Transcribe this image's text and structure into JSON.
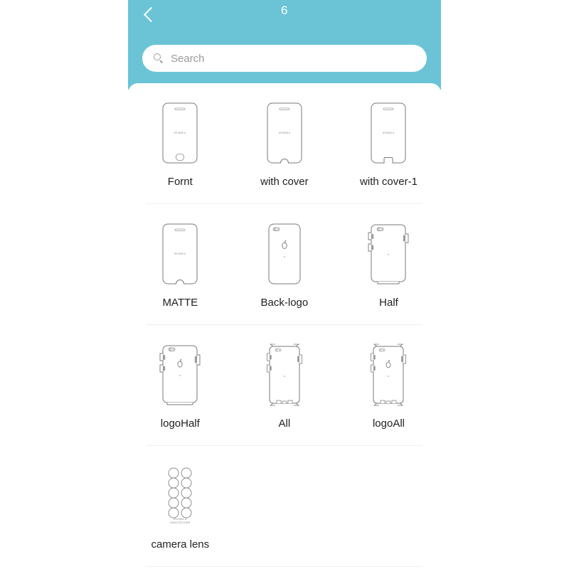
{
  "header": {
    "title": "6",
    "back_icon": "chevron-left-icon",
    "accent_color": "#6ac4d6"
  },
  "search": {
    "icon": "search-icon",
    "placeholder": "Search",
    "value": ""
  },
  "grid": {
    "rows": [
      {
        "items": [
          {
            "label": "Fornt",
            "art": "phone-front",
            "screen_text": "IPHONE 6"
          },
          {
            "label": "with cover",
            "art": "phone-front-notch",
            "screen_text": "IPHONE 6"
          },
          {
            "label": "with cover-1",
            "art": "phone-front-cut",
            "screen_text": "IPHONE 6"
          }
        ]
      },
      {
        "items": [
          {
            "label": "MATTE",
            "art": "phone-front-notch",
            "screen_text": "IPHONE 6"
          },
          {
            "label": "Back-logo",
            "art": "phone-back-logo",
            "screen_text": ""
          },
          {
            "label": "Half",
            "art": "phone-back-half",
            "screen_text": ""
          }
        ]
      },
      {
        "items": [
          {
            "label": "logoHalf",
            "art": "phone-back-logo-half",
            "screen_text": ""
          },
          {
            "label": "All",
            "art": "phone-back-all",
            "screen_text": ""
          },
          {
            "label": "logoAll",
            "art": "phone-back-logo-all",
            "screen_text": ""
          }
        ]
      },
      {
        "items": [
          {
            "label": "camera lens",
            "art": "camera-lens-sheet",
            "screen_text": "IPHONE 6 LENS STICKER"
          }
        ]
      }
    ]
  }
}
